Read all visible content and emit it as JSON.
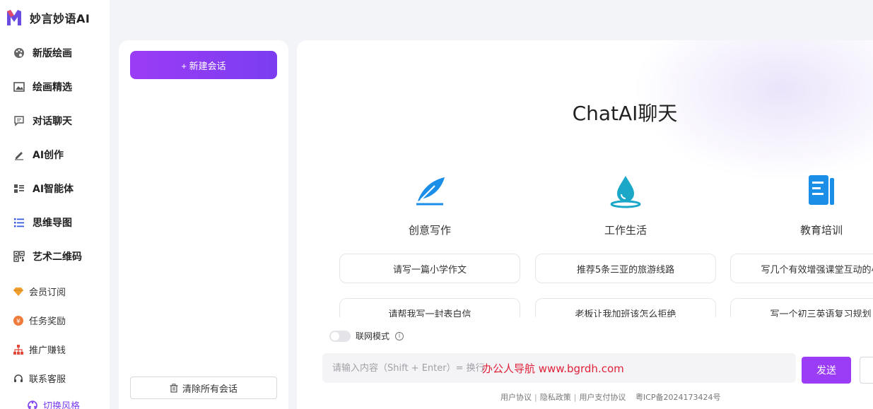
{
  "brand": {
    "name": "妙言妙语AI"
  },
  "nav": [
    {
      "label": "新版绘画",
      "icon": "palette-icon"
    },
    {
      "label": "绘画精选",
      "icon": "image-icon"
    },
    {
      "label": "对话聊天",
      "icon": "chat-icon"
    },
    {
      "label": "AI创作",
      "icon": "pen-icon"
    },
    {
      "label": "AI智能体",
      "icon": "grid-list-icon"
    },
    {
      "label": "思维导图",
      "icon": "list-icon"
    },
    {
      "label": "艺术二维码",
      "icon": "qrcode-icon"
    }
  ],
  "sub_nav": [
    {
      "label": "会员订阅",
      "icon": "diamond-icon"
    },
    {
      "label": "任务奖励",
      "icon": "coin-icon"
    },
    {
      "label": "推广赚钱",
      "icon": "network-icon"
    },
    {
      "label": "联系客服",
      "icon": "headset-icon"
    },
    {
      "label": "切换风格",
      "icon": "style-icon"
    }
  ],
  "conversations": {
    "new_label": "+ 新建会话",
    "clear_label": "清除所有会话"
  },
  "main": {
    "title": "ChatAI聊天",
    "categories": [
      {
        "label": "创意写作",
        "icon": "quill-icon"
      },
      {
        "label": "工作生活",
        "icon": "drop-icon"
      },
      {
        "label": "教育培训",
        "icon": "document-icon"
      }
    ],
    "prompts": [
      [
        "请写一篇小学作文",
        "推荐5条三亚的旅游线路",
        "写几个有效增强课堂互动的小"
      ],
      [
        "请帮我写一封表白信",
        "老板让我加班该怎么拒绝",
        "写一个初三英语复习规划"
      ]
    ],
    "net_mode_label": "联网模式",
    "input_placeholder": "请输入内容（Shift + Enter）= 换行",
    "watermark": "办公人导航  www.bgrdh.com",
    "send_label": "发送"
  },
  "footer": {
    "links": [
      "用户协议",
      "隐私政策",
      "用户支付协议"
    ],
    "icp": "粤ICP备2024173424号"
  },
  "colors": {
    "accent": "#9b3cf6",
    "watermark": "#e0213a",
    "icon_blue": "#1b8ee8"
  }
}
